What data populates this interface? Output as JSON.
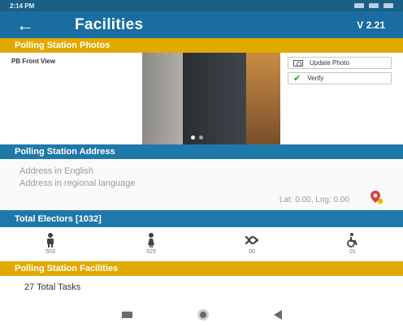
{
  "status_bar": {
    "time": "2:14 PM"
  },
  "app_bar": {
    "title": "Facilities",
    "version": "V 2.21"
  },
  "photos": {
    "header": "Polling Station Photos",
    "label": "PB Front View",
    "update_label": "Update Photo",
    "verify_label": "Verify"
  },
  "address": {
    "header": "Polling Station Address",
    "english": "Address in English",
    "regional": "Address in regional language",
    "latlng": "Lat: 0.00, Lng: 0.00"
  },
  "electors": {
    "header": "Total Electors [1032]",
    "items": [
      {
        "icon": "male-voter-icon",
        "count": "503"
      },
      {
        "icon": "female-voter-icon",
        "count": "529"
      },
      {
        "icon": "third-gender-icon",
        "count": "00"
      },
      {
        "icon": "wheelchair-icon",
        "count": "01"
      }
    ]
  },
  "facilities": {
    "header": "Polling Station Facilities",
    "tasks": "27 Total Tasks"
  },
  "colors": {
    "primary": "#1a6da0",
    "accent": "#e2a900"
  }
}
